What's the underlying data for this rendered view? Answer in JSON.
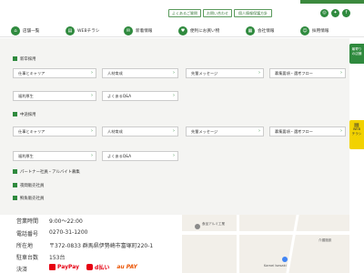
{
  "topbar": {
    "links": [
      "よくあるご質問",
      "お問い合わせ",
      "個人情報保護方針"
    ],
    "social_icons": [
      "instagram-icon",
      "twitter-icon",
      "facebook-icon"
    ]
  },
  "nav": [
    {
      "label": "店舗一覧",
      "icon": "store-icon"
    },
    {
      "label": "WEBチラシ",
      "icon": "flyer-icon"
    },
    {
      "label": "新着情報",
      "icon": "news-icon"
    },
    {
      "label": "便利にお買い物",
      "icon": "cart-icon"
    },
    {
      "label": "会社情報",
      "icon": "company-icon"
    },
    {
      "label": "採用情報",
      "icon": "recruit-icon"
    }
  ],
  "sidebar_buttons": {
    "store_search": "最寄り\nの店舗",
    "chirashi": "WEB\nチラシ"
  },
  "dropdown": {
    "new_grad": {
      "title": "新卒採用",
      "items": [
        "仕事とキャリア",
        "人材育成",
        "先輩メッセージ",
        "募集要項・選考フロー",
        "福利厚生",
        "よくあるQ&A"
      ]
    },
    "mid_career": {
      "title": "中途採用",
      "items": [
        "仕事とキャリア",
        "人材育成",
        "先輩メッセージ",
        "募集要項・選考フロー",
        "福利厚生",
        "よくあるQ&A"
      ]
    },
    "other": [
      "パートナー社員・アルバイト募集",
      "夜間販売社員",
      "鮮魚販売社員"
    ]
  },
  "info": {
    "rows": [
      {
        "label": "営業時間",
        "value": "9:00～22:00"
      },
      {
        "label": "電話番号",
        "value": "0270-31-1200"
      },
      {
        "label": "所在地",
        "value": "〒372-0833 群馬県伊勢崎市富塚町220-1"
      },
      {
        "label": "駐車台数",
        "value": "153台"
      },
      {
        "label": "決済",
        "value": ""
      }
    ],
    "payments": [
      "PayPay",
      "d払い",
      "au PAY"
    ]
  },
  "map": {
    "labels": [
      "食品アルミ工業",
      "Kamei Isesaki",
      "介護施設"
    ]
  }
}
